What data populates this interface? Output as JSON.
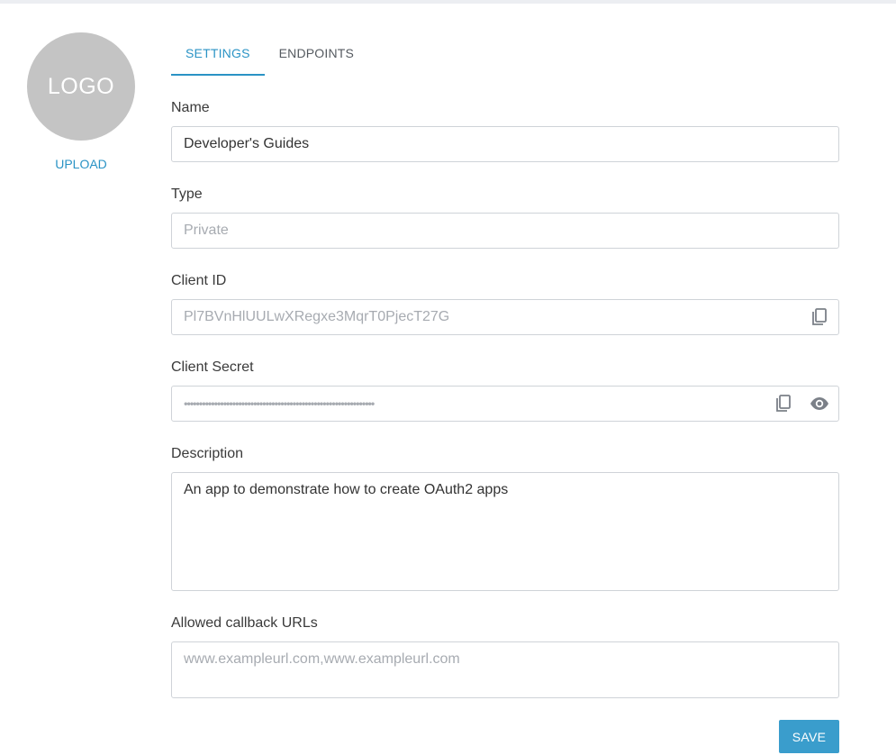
{
  "sidebar": {
    "logo_text": "LOGO",
    "upload_label": "UPLOAD"
  },
  "tabs": [
    {
      "label": "SETTINGS",
      "active": true
    },
    {
      "label": "ENDPOINTS",
      "active": false
    }
  ],
  "form": {
    "name": {
      "label": "Name",
      "value": "Developer's Guides"
    },
    "type": {
      "label": "Type",
      "placeholder": "Private"
    },
    "client_id": {
      "label": "Client ID",
      "value": "Pl7BVnHlUULwXRegxe3MqrT0PjecT27G",
      "icon": "copy-icon"
    },
    "client_secret": {
      "label": "Client Secret",
      "masked_value": "•••••••••••••••••••••••••••••••••••••••••••••••••••••••••••••••",
      "icons": [
        "copy-icon",
        "eye-icon"
      ]
    },
    "description": {
      "label": "Description",
      "value": "An app to demonstrate how to create OAuth2 apps"
    },
    "callback_urls": {
      "label": "Allowed callback URLs",
      "placeholder": "www.exampleurl.com,www.exampleurl.com"
    }
  },
  "actions": {
    "save_label": "SAVE"
  },
  "colors": {
    "accent": "#2a93c5",
    "button": "#3a9dcc",
    "logo_bg": "#c4c4c4",
    "border": "#cfd3d8",
    "placeholder": "#a7abb1"
  }
}
